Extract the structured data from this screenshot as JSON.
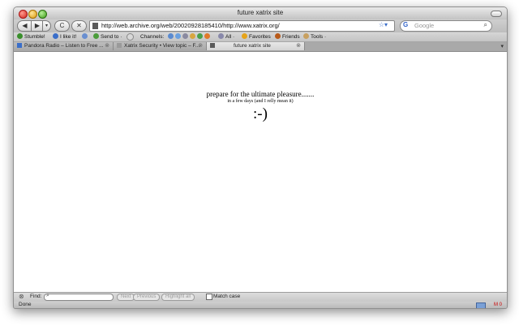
{
  "window": {
    "title": "future xatrix site"
  },
  "toolbar": {
    "back_glyph": "◀",
    "forward_glyph": "▶",
    "history_glyph": "▾",
    "reload_glyph": "C",
    "stop_glyph": "✕",
    "url": "http://web.archive.org/web/20020928185410/http://www.xatrix.org/",
    "star_glyph": "☆▾",
    "search_engine": "G",
    "search_placeholder": "Google",
    "search_glyph": "⌕"
  },
  "bookmarks": {
    "items": [
      {
        "label": "Stumble!",
        "color": "#3a8f2c"
      },
      {
        "label": "I like it!",
        "color": "#3a6ec9"
      },
      {
        "label": "",
        "color": "#6a8fd0"
      },
      {
        "label": "Send to ·",
        "color": "#4c9d3b"
      },
      {
        "label": "",
        "color": "#d8d8d8"
      },
      {
        "label": "Channels:",
        "color": ""
      },
      {
        "label": "All ·",
        "color": "#8888aa"
      },
      {
        "label": "Favorites",
        "color": "#e6a31a"
      },
      {
        "label": "Friends",
        "color": "#b85a1a"
      },
      {
        "label": "Tools ·",
        "color": "#c8a060"
      }
    ]
  },
  "tabs": [
    {
      "label": "Pandora Radio – Listen to Free ...",
      "close": "⊗",
      "active": false
    },
    {
      "label": "Xatrix Security • View topic – F...",
      "close": "⊗",
      "active": false
    },
    {
      "label": "future xatrix site",
      "close": "⊗",
      "active": true
    }
  ],
  "tab_menu_glyph": "▾",
  "page": {
    "line1": "prepare for the ultimate pleasure.......",
    "line2": "in a few days (and I relly mean it)",
    "line3": ":-)"
  },
  "findbar": {
    "close_glyph": "⊗",
    "label": "Find:",
    "mag": "⌕",
    "next": "Next",
    "previous": "Previous",
    "highlight": "Highlight all",
    "match_case": "Match case"
  },
  "status": {
    "text": "Done",
    "mail_glyph": "M 0"
  }
}
